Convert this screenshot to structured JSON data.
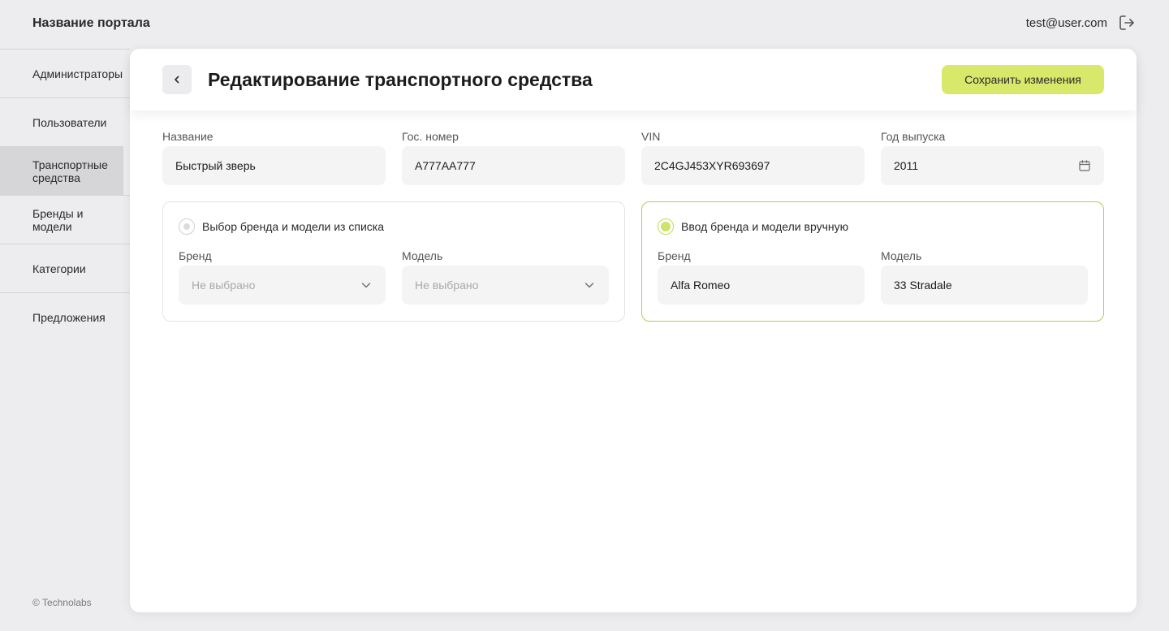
{
  "header": {
    "portal_title": "Название портала",
    "user_email": "test@user.com"
  },
  "sidebar": {
    "items": [
      {
        "label": "Администраторы",
        "active": false
      },
      {
        "label": "Пользователи",
        "active": false
      },
      {
        "label": "Транспортные средства",
        "active": true
      },
      {
        "label": "Бренды и модели",
        "active": false
      },
      {
        "label": "Категории",
        "active": false
      },
      {
        "label": "Предложения",
        "active": false
      }
    ],
    "footer": "© Technolabs"
  },
  "main": {
    "title": "Редактирование транспортного средства",
    "save_label": "Сохранить изменения",
    "fields": [
      {
        "label": "Название",
        "value": "Быстрый зверь"
      },
      {
        "label": "Гос. номер",
        "value": "A777AA777"
      },
      {
        "label": "VIN",
        "value": "2C4GJ453XYR693697"
      },
      {
        "label": "Год выпуска",
        "value": "2011"
      }
    ],
    "list_option": {
      "label": "Выбор бренда и модели из списка",
      "checked": false,
      "brand_label": "Бренд",
      "brand_placeholder": "Не выбрано",
      "model_label": "Модель",
      "model_placeholder": "Не выбрано"
    },
    "manual_option": {
      "label": "Ввод бренда и модели вручную",
      "checked": true,
      "brand_label": "Бренд",
      "brand_value": "Alfa Romeo",
      "model_label": "Модель",
      "model_value": "33 Stradale"
    }
  },
  "colors": {
    "accent": "#d7e86a",
    "selected_border": "#b5cc52",
    "background": "#ededef",
    "active_nav": "#d6d6d8"
  },
  "icons": [
    "logout-icon",
    "chevron-left-icon",
    "calendar-icon",
    "chevron-down-icon"
  ]
}
